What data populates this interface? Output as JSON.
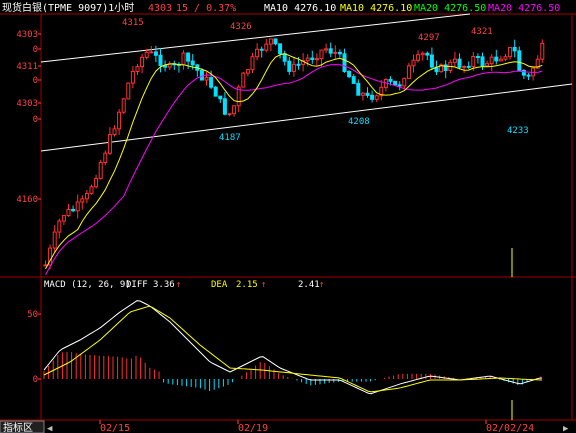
{
  "header": {
    "instrument": "现货白银(TPME 9097)1小时",
    "price": "4303",
    "change": "15 / 0.37%",
    "indicators": [
      {
        "label": "MA10 4276.10",
        "color": "#ffffff"
      },
      {
        "label": "MA10 4276.10",
        "color": "#ffff00"
      },
      {
        "label": "MA20 4276.50",
        "color": "#00ff00"
      },
      {
        "label": "MA20 4276.50",
        "color": "#ff00ff"
      }
    ]
  },
  "price_axis_labels": [
    "4303",
    "0",
    "4311",
    "0",
    "4303",
    "0",
    "4160"
  ],
  "annotations": [
    "4315",
    "4326",
    "4297",
    "4321",
    "4187",
    "4208",
    "4233"
  ],
  "macd": {
    "title": "MACD (12, 26, 9)",
    "diff_label": "DIFF",
    "diff_value": "3.36",
    "dea_label": "DEA",
    "dea_value": "2.15",
    "macd_value": "2.41",
    "axis_labels": [
      "50",
      "0"
    ]
  },
  "date_labels": [
    "02/15",
    "02/19",
    "02/02/24"
  ],
  "bottom": {
    "tab_label": "指标区",
    "arrow_left": "◀",
    "arrow_right": "▶"
  },
  "colors": {
    "up": "#ff3030",
    "down": "#00e0ff",
    "macd_diff": "#ffffff",
    "macd_dea": "#ffff00",
    "ma_white": "#ffffff",
    "ma_yellow": "#ffff00",
    "ma_magenta": "#ff00ff",
    "grid": "#a00000"
  }
}
